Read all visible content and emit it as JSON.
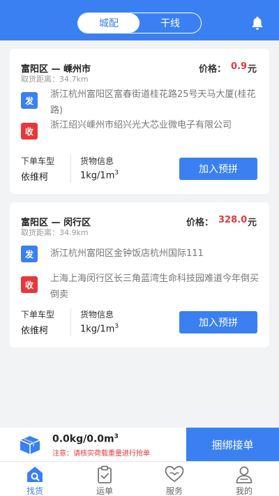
{
  "header": {
    "tabs": [
      {
        "label": "城配",
        "active": true
      },
      {
        "label": "干线",
        "active": false
      }
    ],
    "bell_icon": "bell-icon"
  },
  "orders": [
    {
      "route": "富阳区 — 嵊州市",
      "distance": "取货距离：34.7km",
      "price_label": "价格：",
      "price_value": "0.9",
      "price_unit": "元",
      "sender_badge": "发",
      "sender_address": "浙江杭州富阳区富春街道桂花路25号天马大厦(桂花路)",
      "receiver_badge": "收",
      "receiver_address": "浙江绍兴嵊州市绍兴光大芯业微电子有限公司",
      "vehicle_label": "下单车型",
      "vehicle_value": "依维柯",
      "cargo_label": "货物信息",
      "cargo_value": "1kg/1m",
      "cargo_sup": "3",
      "join_label": "加入预拼"
    },
    {
      "route": "富阳区 — 闵行区",
      "distance": "取货距离：34.9km",
      "price_label": "价格：",
      "price_value": "328.0",
      "price_unit": "元",
      "sender_badge": "发",
      "sender_address": "浙江杭州富阳区金钟饭店杭州国际111",
      "receiver_badge": "收",
      "receiver_address": "上海上海闵行区长三角蓝湾生命科技园难道今年倒买倒卖",
      "vehicle_label": "下单车型",
      "vehicle_value": "依维柯",
      "cargo_label": "货物信息",
      "cargo_value": "1kg/1m",
      "cargo_sup": "3",
      "join_label": "加入预拼"
    }
  ],
  "bundle": {
    "weight": "0.0kg/0.0m",
    "weight_sup": "3",
    "note": "注意：请核实荷载重量进行抢单",
    "button": "捆绑接单"
  },
  "tabbar": [
    {
      "label": "找货",
      "icon": "home-search-icon",
      "active": true
    },
    {
      "label": "运单",
      "icon": "clipboard-icon",
      "active": false
    },
    {
      "label": "服务",
      "icon": "heart-handshake-icon",
      "active": false
    },
    {
      "label": "我的",
      "icon": "user-icon",
      "active": false
    }
  ],
  "colors": {
    "primary": "#3a80f3",
    "price": "#e6383c",
    "background": "#f2f3f5"
  }
}
